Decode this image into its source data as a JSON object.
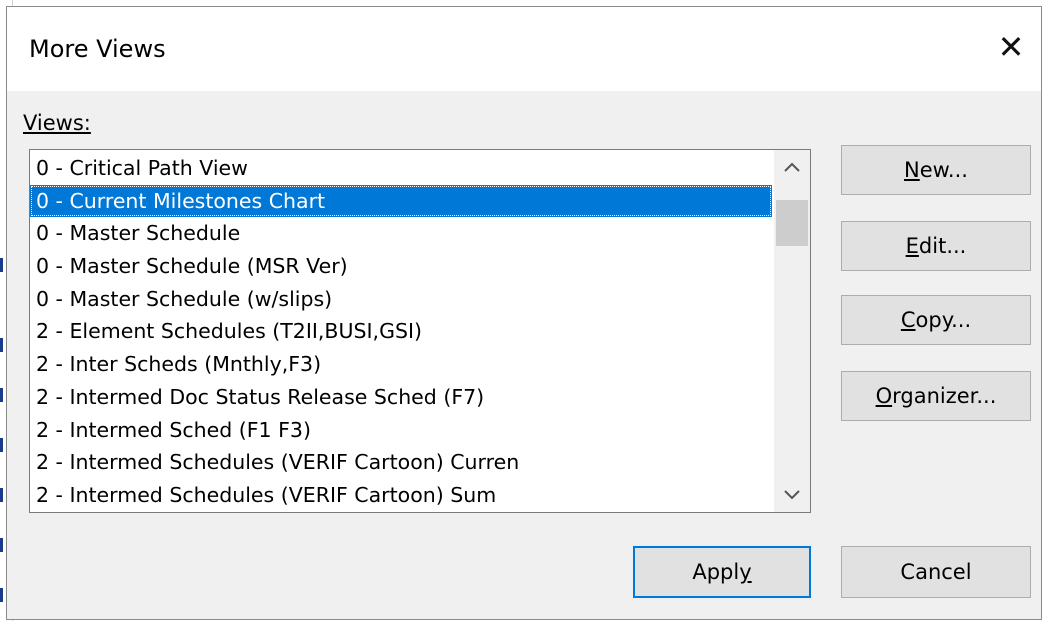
{
  "dialog": {
    "title": "More Views",
    "close_glyph": "✕"
  },
  "views_label": "Views:",
  "views": [
    "0 - Critical Path View",
    "0 - Current Milestones Chart",
    "0 - Master Schedule",
    "0 - Master Schedule (MSR Ver)",
    "0 - Master Schedule (w/slips)",
    "2 - Element Schedules (T2II,BUSI,GSI)",
    "2 - Inter Scheds (Mnthly,F3)",
    "2 - Intermed Doc Status Release Sched (F7)",
    "2 - Intermed Sched (F1 F3)",
    "2 - Intermed Schedules (VERIF Cartoon) Curren",
    "2 - Intermed Schedules (VERIF Cartoon) Sum"
  ],
  "selected_view": "0 - Current Milestones Chart",
  "buttons": {
    "new": "New...",
    "edit": "Edit...",
    "copy": "Copy...",
    "organizer": "Organizer...",
    "apply": "Apply",
    "cancel": "Cancel"
  },
  "scrollbar": {
    "up_icon": "chevron-up-icon",
    "down_icon": "chevron-down-icon"
  },
  "colors": {
    "selection": "#0078d7",
    "dialog_bg": "#f0f0f0",
    "button_bg": "#e1e1e1"
  }
}
